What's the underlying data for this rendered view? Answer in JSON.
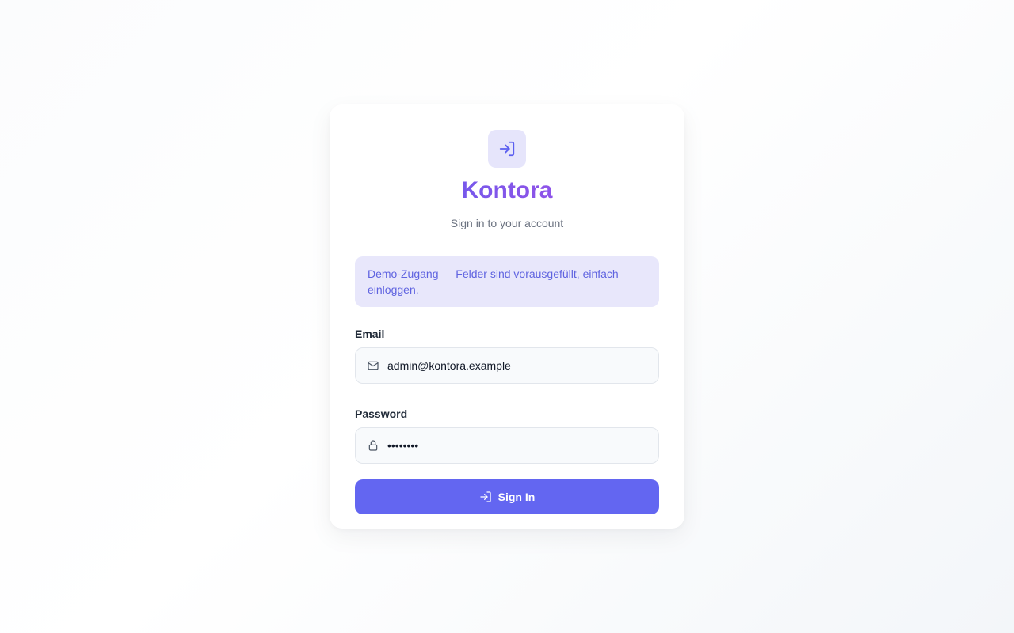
{
  "brand": {
    "name": "Kontora",
    "subtitle": "Sign in to your account",
    "logo_icon": "log-in-icon"
  },
  "notice": {
    "text": "Demo-Zugang — Felder sind vorausgefüllt, einfach einloggen."
  },
  "form": {
    "email": {
      "label": "Email",
      "value": "admin@kontora.example",
      "icon": "mail-icon"
    },
    "password": {
      "label": "Password",
      "value": "demopass",
      "icon": "lock-icon"
    },
    "submit_label": "Sign In",
    "submit_icon": "log-in-icon"
  },
  "colors": {
    "accent": "#6366f1",
    "notice_bg": "#e8e7fb",
    "notice_text": "#5f63e0",
    "logo_bg": "#e6e5fb"
  }
}
